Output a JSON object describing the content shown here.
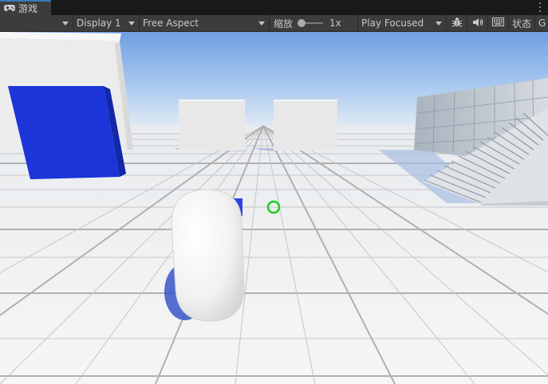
{
  "tab": {
    "label": "游戏",
    "icon": "gamepad-icon"
  },
  "toolbar": {
    "display": "Display 1",
    "aspect": "Free Aspect",
    "zoom_label": "缩放",
    "zoom_value": "1x",
    "zoom_level": 1,
    "play_mode": "Play Focused",
    "stats_label": "状态",
    "gizmos_label": "G"
  },
  "colors": {
    "panel": "#3c3c3c",
    "tab_accent": "#3a79bb",
    "sky": "#8fb7ea",
    "floor": "#f1f1f1",
    "cube_blue": "#1b35d9",
    "crosshair": "#1fcc1f"
  }
}
